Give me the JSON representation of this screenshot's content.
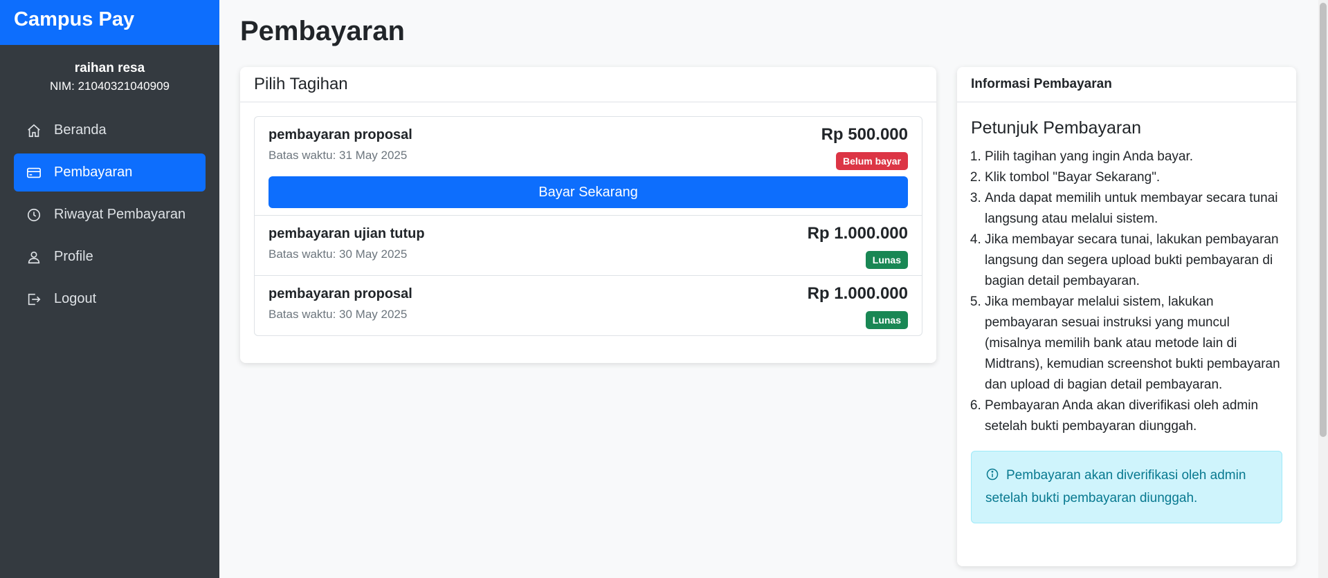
{
  "app": {
    "brand": "Campus Pay"
  },
  "user": {
    "name": "raihan resa",
    "nim": "NIM: 21040321040909"
  },
  "sidebar": {
    "items": [
      {
        "label": "Beranda",
        "icon": "home-icon"
      },
      {
        "label": "Pembayaran",
        "icon": "credit-card-icon",
        "active": true
      },
      {
        "label": "Riwayat Pembayaran",
        "icon": "clock-icon"
      },
      {
        "label": "Profile",
        "icon": "user-icon"
      },
      {
        "label": "Logout",
        "icon": "logout-icon"
      }
    ]
  },
  "page": {
    "title": "Pembayaran"
  },
  "bills": {
    "header": "Pilih Tagihan",
    "items": [
      {
        "title": "pembayaran proposal",
        "due": "Batas waktu: 31 May 2025",
        "amount": "Rp 500.000",
        "status": "Belum bayar",
        "action": "Bayar Sekarang"
      },
      {
        "title": "pembayaran ujian tutup",
        "due": "Batas waktu: 30 May 2025",
        "amount": "Rp 1.000.000",
        "status": "Lunas"
      },
      {
        "title": "pembayaran proposal",
        "due": "Batas waktu: 30 May 2025",
        "amount": "Rp 1.000.000",
        "status": "Lunas"
      }
    ]
  },
  "info": {
    "header": "Informasi Pembayaran",
    "heading": "Petunjuk Pembayaran",
    "steps": [
      "Pilih tagihan yang ingin Anda bayar.",
      "Klik tombol \"Bayar Sekarang\".",
      "Anda dapat memilih untuk membayar secara tunai langsung atau melalui sistem.",
      "Jika membayar secara tunai, lakukan pembayaran langsung dan segera upload bukti pembayaran di bagian detail pembayaran.",
      "Jika membayar melalui sistem, lakukan pembayaran sesuai instruksi yang muncul (misalnya memilih bank atau metode lain di Midtrans), kemudian screenshot bukti pembayaran dan upload di bagian detail pembayaran.",
      "Pembayaran Anda akan diverifikasi oleh admin setelah bukti pembayaran diunggah."
    ],
    "alert": "Pembayaran akan diverifikasi oleh admin setelah bukti pembayaran diunggah."
  },
  "colors": {
    "primary": "#0d6efd",
    "sidebar": "#343a40",
    "danger": "#dc3545",
    "success": "#198754",
    "info_bg": "#cff4fc"
  }
}
